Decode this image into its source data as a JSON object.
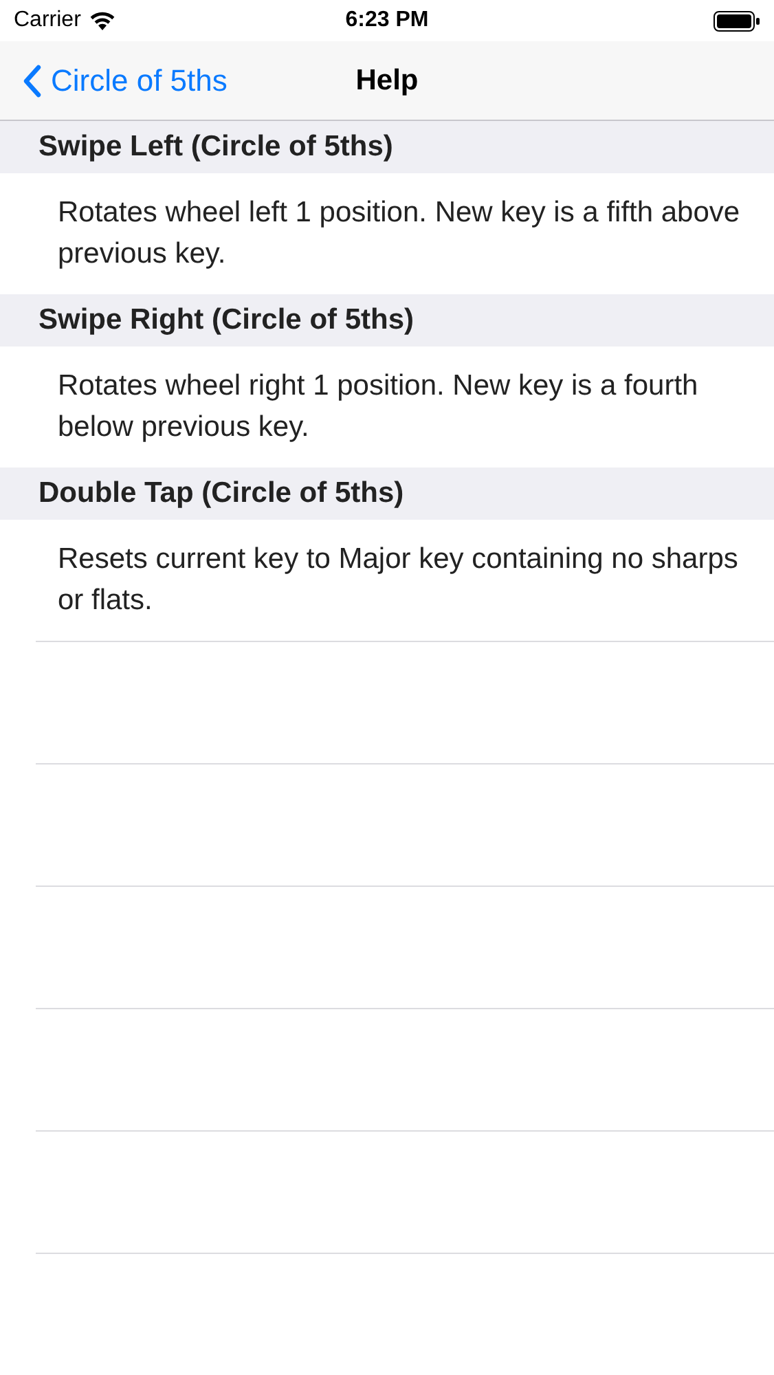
{
  "status_bar": {
    "carrier": "Carrier",
    "time": "6:23 PM"
  },
  "nav_bar": {
    "back": "Circle of 5ths",
    "title": "Help"
  },
  "sections": [
    {
      "header": "Swipe Left (Circle of 5ths)",
      "text": "Rotates wheel left 1 position.  New key is a fifth above previous key."
    },
    {
      "header": "Swipe Right (Circle of 5ths)",
      "text": "Rotates wheel right 1 position.  New key is a fourth below previous key."
    },
    {
      "header": "Double Tap (Circle of 5ths)",
      "text": "Resets current key to Major key containing no sharps or flats."
    }
  ]
}
